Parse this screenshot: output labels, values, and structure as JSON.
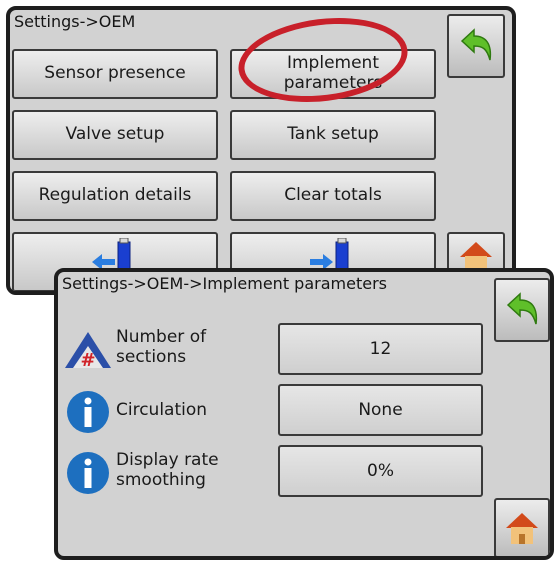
{
  "colors": {
    "panel_bg": "#d2d2d2",
    "panel_border": "#1e1e1e",
    "highlight": "#c8202a",
    "back_arrow": "#5fbf2a",
    "info_icon": "#1d6fbf"
  },
  "settings_oem": {
    "title": "Settings->OEM",
    "buttons": {
      "sensor_presence": "Sensor presence",
      "implement_parameters_line1": "Implement",
      "implement_parameters_line2": "parameters",
      "valve_setup": "Valve setup",
      "tank_setup": "Tank setup",
      "regulation_details": "Regulation details",
      "clear_totals": "Clear totals"
    },
    "icons": {
      "back": "back-arrow-icon",
      "home": "home-icon",
      "usb_import": "usb-import-icon",
      "usb_export": "usb-export-icon"
    }
  },
  "implement_parameters": {
    "title": "Settings->OEM->Implement parameters",
    "rows": [
      {
        "icon": "number-of-sections-icon",
        "label_line1": "Number of",
        "label_line2": "sections",
        "value": "12"
      },
      {
        "icon": "info-icon",
        "label_line1": "Circulation",
        "label_line2": "",
        "value": "None"
      },
      {
        "icon": "info-icon",
        "label_line1": "Display rate",
        "label_line2": "smoothing",
        "value": "0%"
      }
    ]
  }
}
